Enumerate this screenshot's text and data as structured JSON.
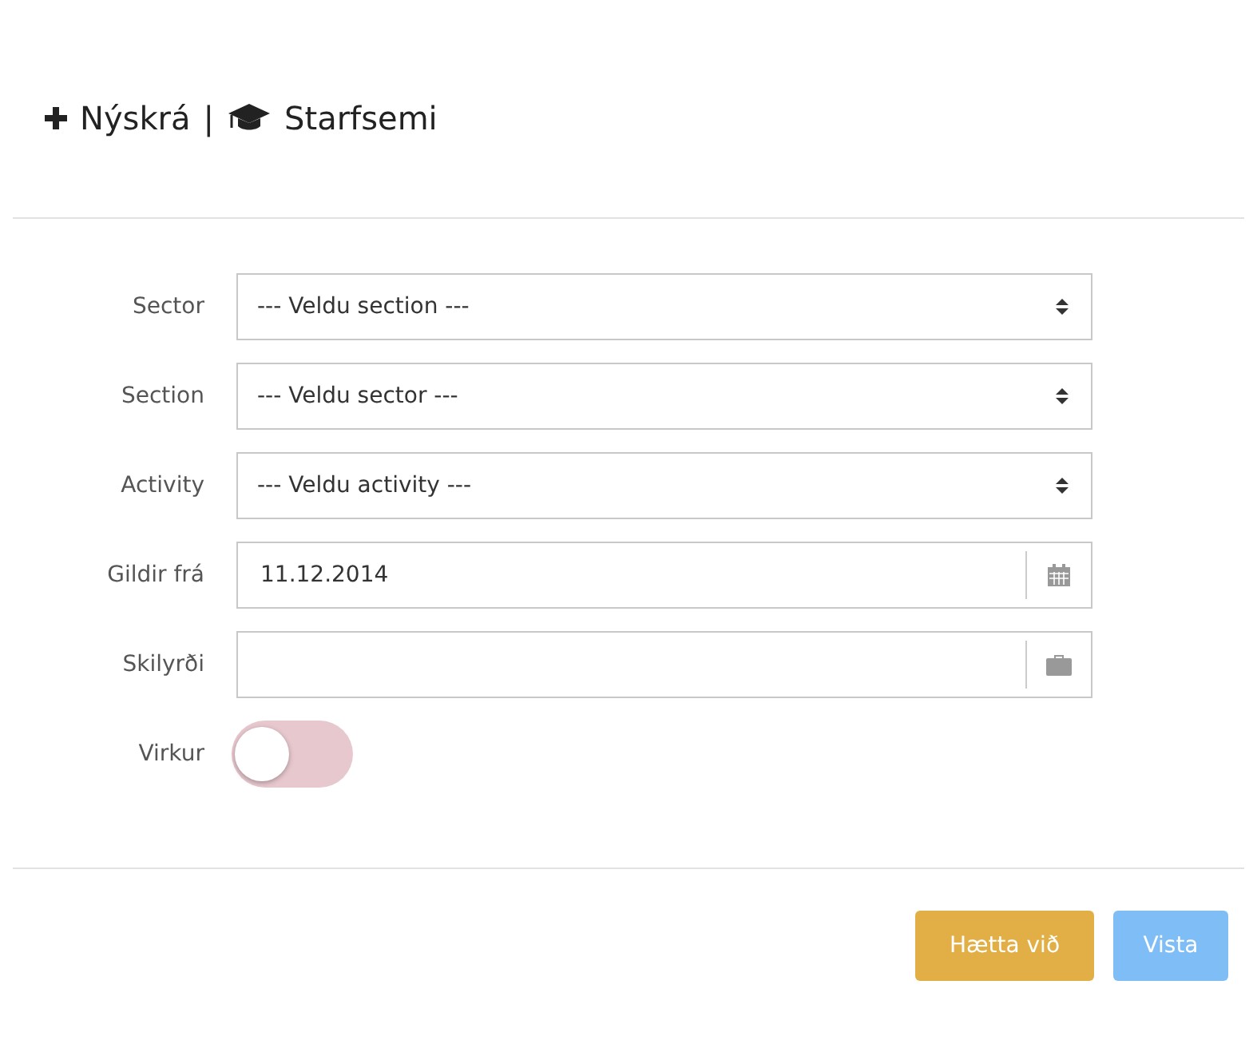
{
  "header": {
    "new_label": "Nýskrá",
    "separator": "|",
    "title": "Starfsemi"
  },
  "fields": [
    {
      "kind": "select",
      "label": "Sector",
      "value": "--- Veldu section ---"
    },
    {
      "kind": "select",
      "label": "Section",
      "value": "--- Veldu sector ---"
    },
    {
      "kind": "select",
      "label": "Activity",
      "value": "--- Veldu activity ---"
    },
    {
      "kind": "date",
      "label": "Gildir frá",
      "value": "11.12.2014"
    },
    {
      "kind": "text",
      "label": "Skilyrði"
    },
    {
      "kind": "toggle",
      "label": "Virkur",
      "on": false
    }
  ],
  "buttons": [
    {
      "kind": "warning",
      "label": "Hætta við",
      "disabled": false
    },
    {
      "kind": "primary",
      "label": "Vista",
      "disabled": true
    }
  ]
}
